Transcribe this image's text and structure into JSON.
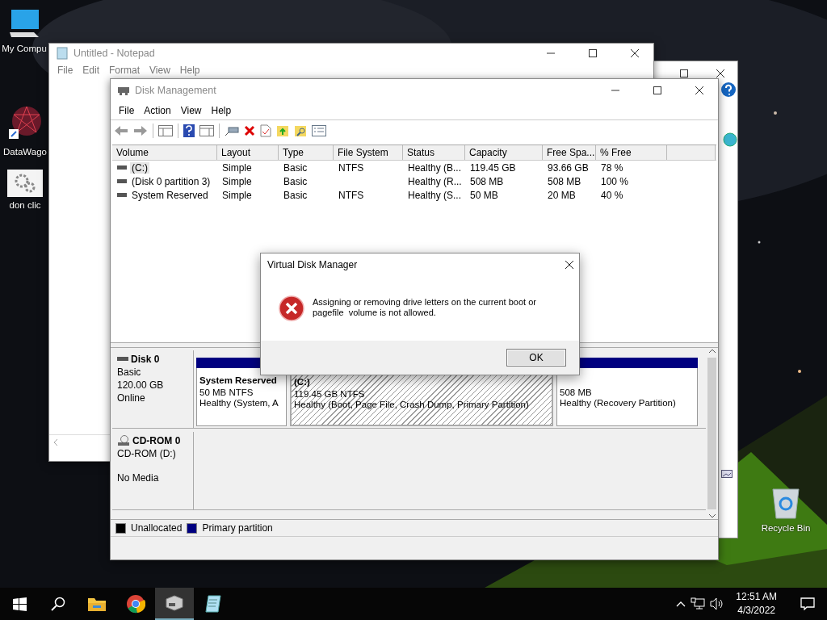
{
  "desktop_icons": [
    {
      "kind": "computer",
      "label": "My Compu"
    },
    {
      "kind": "web",
      "label": "DataWago"
    },
    {
      "kind": "gears",
      "label": "don clic"
    },
    {
      "kind": "recycle",
      "label": "Recycle Bin"
    }
  ],
  "notepad": {
    "title": "Untitled - Notepad",
    "menu": [
      "File",
      "Edit",
      "Format",
      "View",
      "Help"
    ]
  },
  "disk_management": {
    "title": "Disk Management",
    "menu": [
      "File",
      "Action",
      "View",
      "Help"
    ],
    "volumes": {
      "columns": [
        "Volume",
        "Layout",
        "Type",
        "File System",
        "Status",
        "Capacity",
        "Free Spa...",
        "% Free"
      ],
      "rows": [
        {
          "selected": true,
          "cells": [
            "(C:)",
            "Simple",
            "Basic",
            "NTFS",
            "Healthy (B...",
            "119.45 GB",
            "93.66 GB",
            "78 %"
          ]
        },
        {
          "selected": false,
          "cells": [
            "(Disk 0 partition 3)",
            "Simple",
            "Basic",
            "",
            "Healthy (R...",
            "508 MB",
            "508 MB",
            "100 %"
          ]
        },
        {
          "selected": false,
          "cells": [
            "System Reserved",
            "Simple",
            "Basic",
            "NTFS",
            "Healthy (S...",
            "50 MB",
            "20 MB",
            "40 %"
          ]
        }
      ]
    },
    "disks": [
      {
        "kind": "disk",
        "name": "Disk 0",
        "type": "Basic",
        "size": "120.00 GB",
        "state": "Online",
        "partitions": [
          {
            "selected": false,
            "label": "System Reserved",
            "size": "50 MB NTFS",
            "status": "Healthy (System, A"
          },
          {
            "selected": true,
            "label": "(C:)",
            "size": "119.45 GB NTFS",
            "status": "Healthy (Boot, Page File, Crash Dump, Primary Partition)"
          },
          {
            "selected": false,
            "size": "508 MB",
            "status": "Healthy (Recovery Partition)"
          }
        ]
      },
      {
        "kind": "cdrom",
        "name": "CD-ROM 0",
        "type": "CD-ROM (D:)",
        "state": "No Media"
      }
    ],
    "legend": [
      {
        "label": "Unallocated",
        "color": "#000000"
      },
      {
        "label": "Primary partition",
        "color": "#000080"
      }
    ]
  },
  "dialog": {
    "title": "Virtual Disk Manager",
    "message": "Assigning or removing drive letters on the current boot or pagefile  volume is not allowed.",
    "button": "OK"
  },
  "taskbar": {
    "apps": [
      {
        "kind": "explorer",
        "selected": false
      },
      {
        "kind": "chrome",
        "selected": false
      },
      {
        "kind": "diskmgmt",
        "selected": true
      },
      {
        "kind": "notepad",
        "selected": false
      }
    ],
    "time": "12:51 AM",
    "date": "4/3/2022"
  }
}
